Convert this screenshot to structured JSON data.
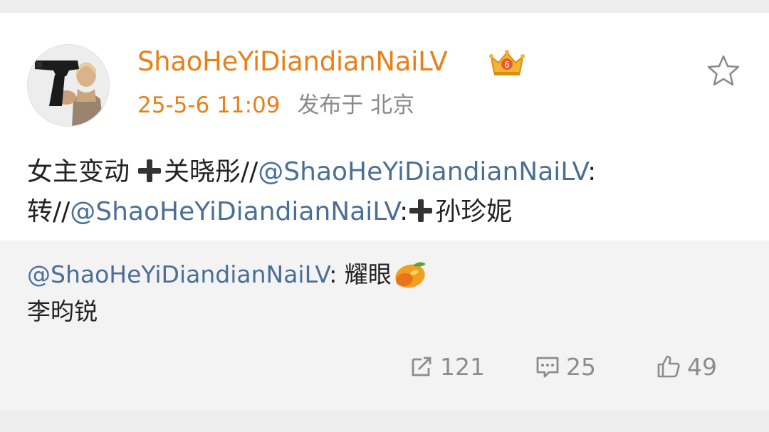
{
  "post": {
    "username": "ShaoHeYiDiandianNaiLV",
    "badge_icon": "vip-crown-icon",
    "timestamp": "25-5-6 11:09",
    "location": "发布于 北京",
    "favorite_icon": "star-icon",
    "content": {
      "line1_text": "女主变动",
      "line1_name": "关晓彤//",
      "line1_mention": "@ShaoHeYiDiandianNaiLV",
      "line1_colon": ":",
      "line2_prefix": "转//",
      "line2_mention": "@ShaoHeYiDiandianNaiLV",
      "line2_colon": ":",
      "line2_name": "孙珍妮"
    }
  },
  "retweet": {
    "mention": "@ShaoHeYiDiandianNaiLV",
    "text": ": 耀眼",
    "emoji": "mango-icon",
    "line2": "李昀锐"
  },
  "actions": {
    "repost_count": "121",
    "comment_count": "25",
    "like_count": "49"
  },
  "colors": {
    "username": "#e8801a",
    "mention": "#4a6f96",
    "meta_gray": "#8a8a8a",
    "action_gray": "#8c8c8c"
  }
}
